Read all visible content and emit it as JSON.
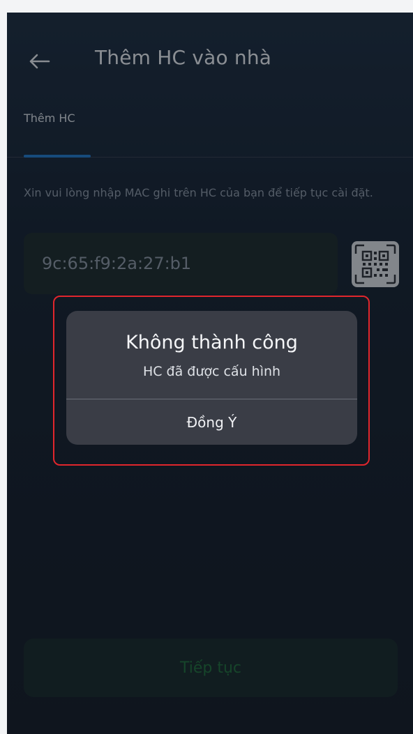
{
  "header": {
    "title": "Thêm HC vào nhà",
    "back_icon": "arrow-left-icon"
  },
  "tabs": [
    {
      "label": "Thêm HC",
      "active": true
    }
  ],
  "form": {
    "instructions": "Xin vui lòng nhập MAC ghi trên HC của bạn để tiếp tục cài đặt.",
    "mac_value": "9c:65:f9:2a:27:b1",
    "qr_icon": "qr-code-scan-icon"
  },
  "dialog": {
    "title": "Không thành công",
    "message": "HC đã được cấu hình",
    "confirm_label": "Đồng Ý"
  },
  "footer": {
    "continue_label": "Tiếp tục"
  },
  "colors": {
    "accent_tab": "#2277c8",
    "highlight_border": "#e1262c",
    "continue_text": "#1f6d3c"
  }
}
